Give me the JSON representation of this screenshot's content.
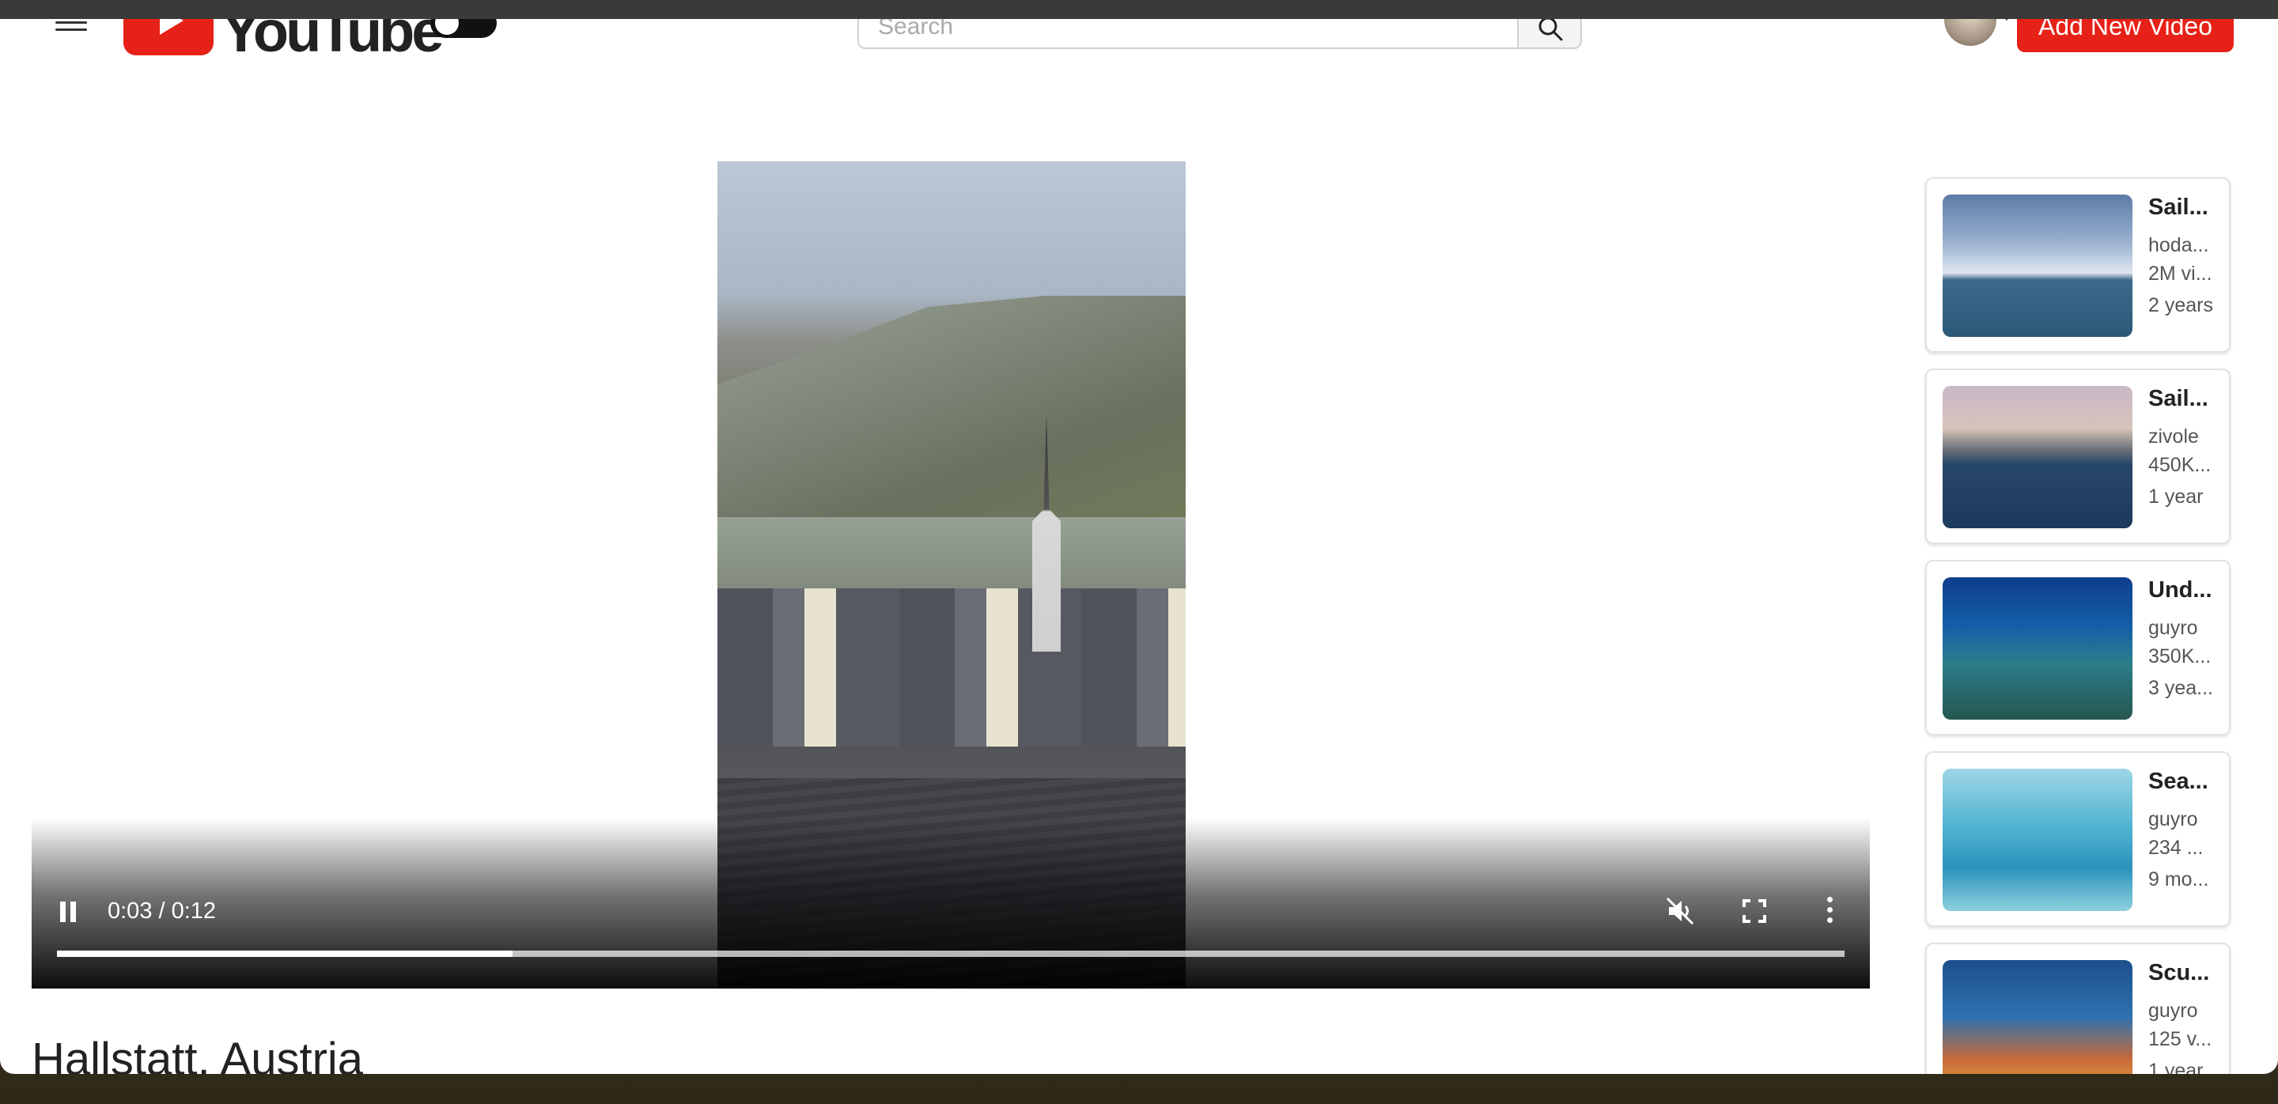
{
  "header": {
    "logo_text": "YouTube",
    "search_placeholder": "Search",
    "add_button_label": "Add New Video"
  },
  "player": {
    "time_display": "0:03 / 0:12",
    "progress_fraction": 0.255,
    "muted": true,
    "playing": true
  },
  "video": {
    "title": "Hallstatt, Austria"
  },
  "sidebar": {
    "cards": [
      {
        "title": "Sail...",
        "channel": "hoda...",
        "views": "2M vi...",
        "age": "2 years",
        "thumb_icon": "sailboat-thumbnail"
      },
      {
        "title": "Sail...",
        "channel": "zivole",
        "views": "450K...",
        "age": "1 year",
        "thumb_icon": "flag-thumbnail"
      },
      {
        "title": "Und...",
        "channel": "guyro",
        "views": "350K...",
        "age": "3 yea...",
        "thumb_icon": "underwater-thumbnail"
      },
      {
        "title": "Sea...",
        "channel": "guyro",
        "views": "234 ...",
        "age": "9 mo...",
        "thumb_icon": "sea-turtle-thumbnail"
      },
      {
        "title": "Scu...",
        "channel": "guyro",
        "views": "125 v...",
        "age": "1 year",
        "thumb_icon": "coral-reef-thumbnail"
      }
    ]
  },
  "colors": {
    "brand_red": "#e62117",
    "text_dark": "#222222"
  }
}
